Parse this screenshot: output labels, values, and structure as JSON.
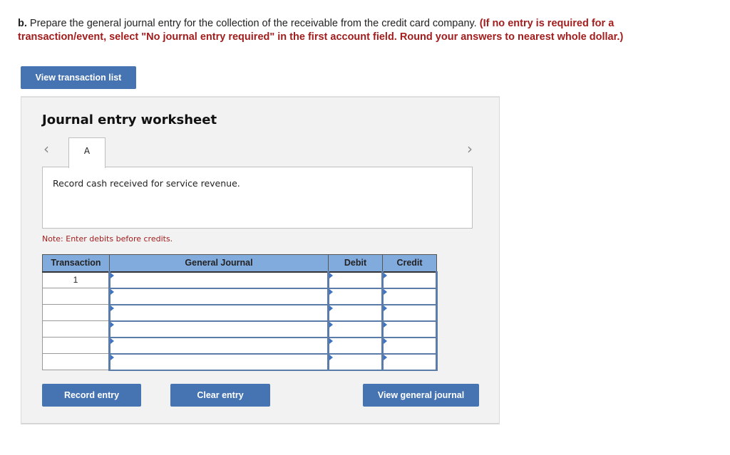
{
  "question": {
    "prefix": "b.",
    "text": " Prepare the general journal entry for the collection of the receivable from the credit card company. ",
    "instruction": "(If no entry is required for a transaction/event, select \"No journal entry required\" in the first account field. Round your answers to nearest whole dollar.)"
  },
  "buttons": {
    "view_transaction_list": "View transaction list",
    "record_entry": "Record entry",
    "clear_entry": "Clear entry",
    "view_general_journal": "View general journal"
  },
  "worksheet": {
    "title": "Journal entry worksheet",
    "prev_icon": "‹",
    "next_icon": "›",
    "tab_label": "A",
    "description": "Record cash received for service revenue.",
    "note": "Note: Enter debits before credits."
  },
  "table": {
    "headers": [
      "Transaction",
      "General Journal",
      "Debit",
      "Credit"
    ],
    "rows": [
      {
        "transaction": "1",
        "account": "",
        "debit": "",
        "credit": ""
      },
      {
        "transaction": "",
        "account": "",
        "debit": "",
        "credit": ""
      },
      {
        "transaction": "",
        "account": "",
        "debit": "",
        "credit": ""
      },
      {
        "transaction": "",
        "account": "",
        "debit": "",
        "credit": ""
      },
      {
        "transaction": "",
        "account": "",
        "debit": "",
        "credit": ""
      },
      {
        "transaction": "",
        "account": "",
        "debit": "",
        "credit": ""
      }
    ]
  },
  "colors": {
    "accent": "#4673b1",
    "header_bg": "#82abdd",
    "instruction_red": "#a21d1d",
    "panel_bg": "#f2f2f2"
  }
}
